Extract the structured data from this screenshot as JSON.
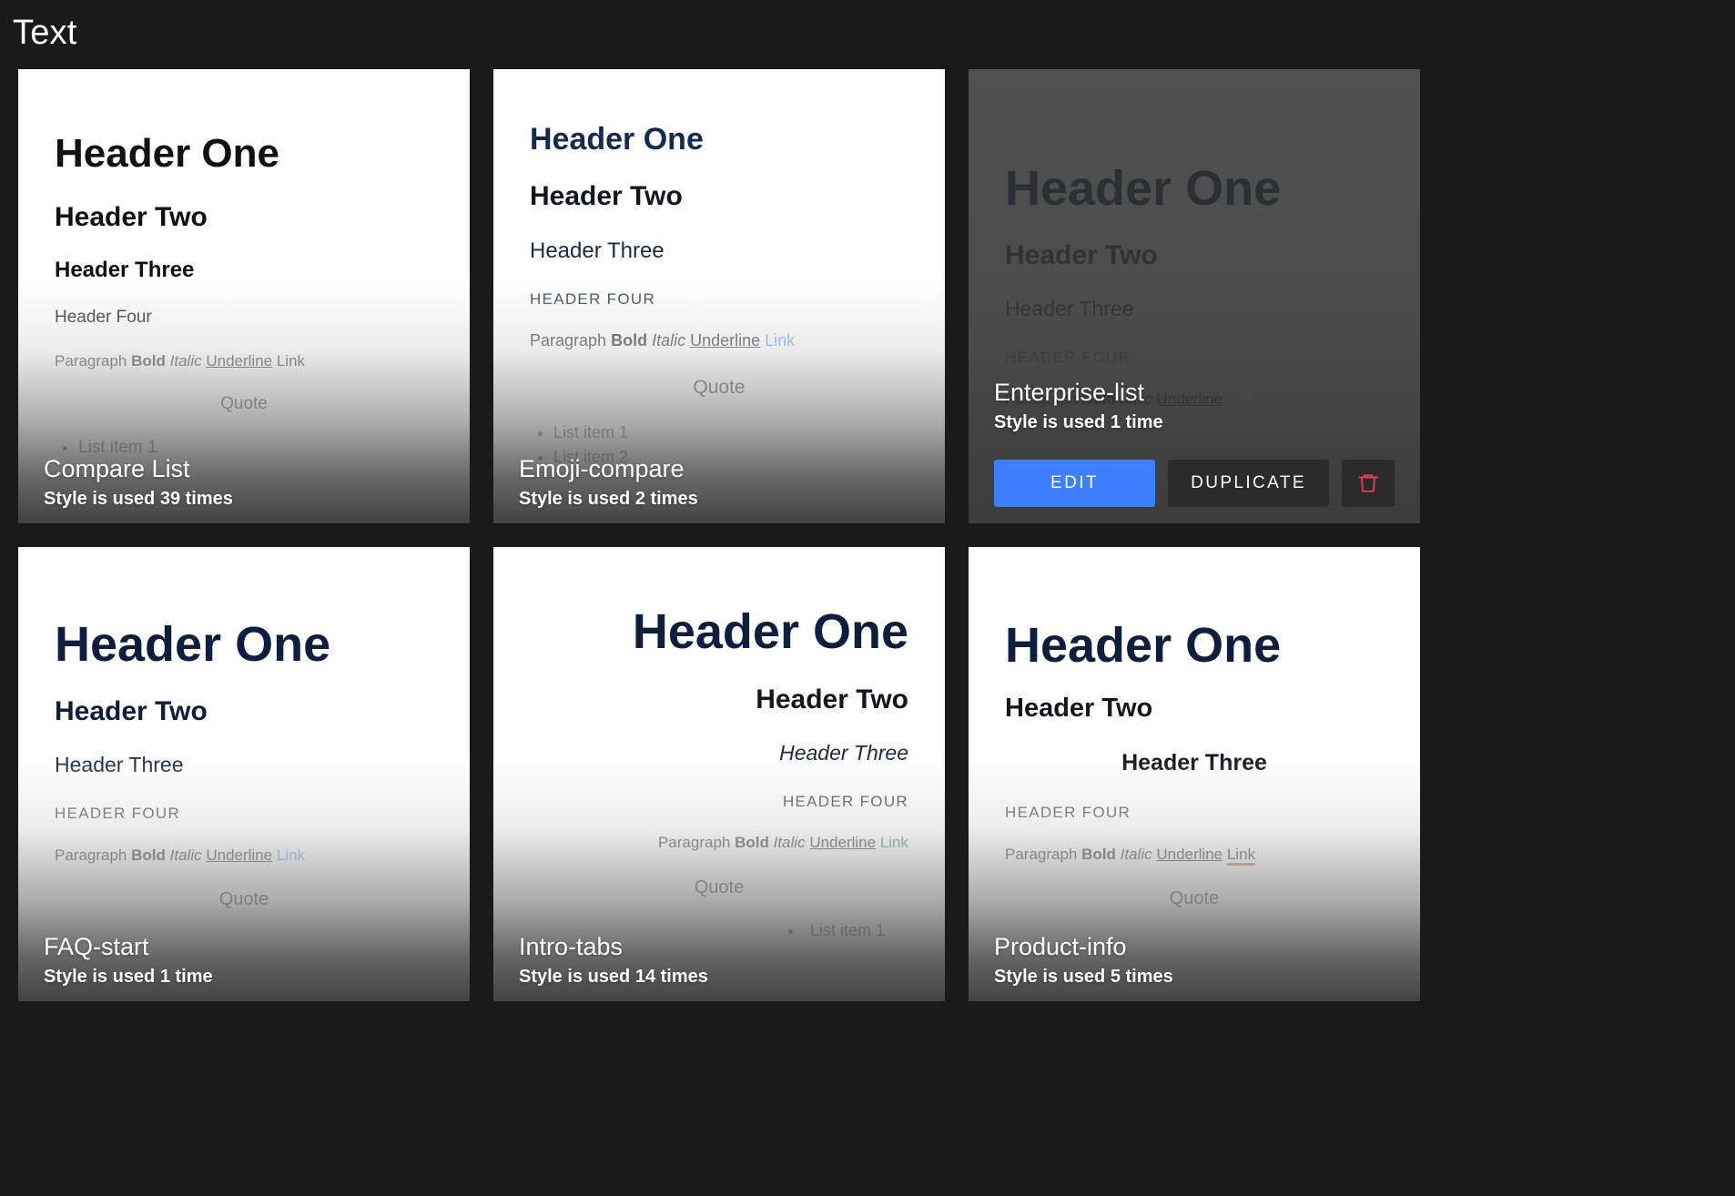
{
  "page": {
    "title": "Text"
  },
  "sample": {
    "h1": "Header One",
    "h2": "Header Two",
    "h3": "Header Three",
    "h4": "Header Four",
    "h4_caps": "HEADER FOUR",
    "paragraph": "Paragraph",
    "bold": "Bold",
    "italic": "Italic",
    "underline": "Underline",
    "link": "Link",
    "quote": "Quote",
    "list_item_1": "List item 1",
    "list_item_2": "List item 2"
  },
  "actions": {
    "edit_label": "EDIT",
    "duplicate_label": "DUPLICATE",
    "delete_icon": "trash-icon",
    "edit_color": "#3d7efd",
    "duplicate_color": "#2b2b2b",
    "delete_color": "#e63a5e"
  },
  "cards": [
    {
      "name": "Compare List",
      "usage": "Style is used 39 times",
      "hovered": false
    },
    {
      "name": "Emoji-compare",
      "usage": "Style is used 2 times",
      "hovered": false
    },
    {
      "name": "Enterprise-list",
      "usage": "Style is used 1 time",
      "hovered": true
    },
    {
      "name": "FAQ-start",
      "usage": "Style is used 1 time",
      "hovered": false
    },
    {
      "name": "Intro-tabs",
      "usage": "Style is used 14 times",
      "hovered": false
    },
    {
      "name": "Product-info",
      "usage": "Style is used 5 times",
      "hovered": false
    }
  ]
}
